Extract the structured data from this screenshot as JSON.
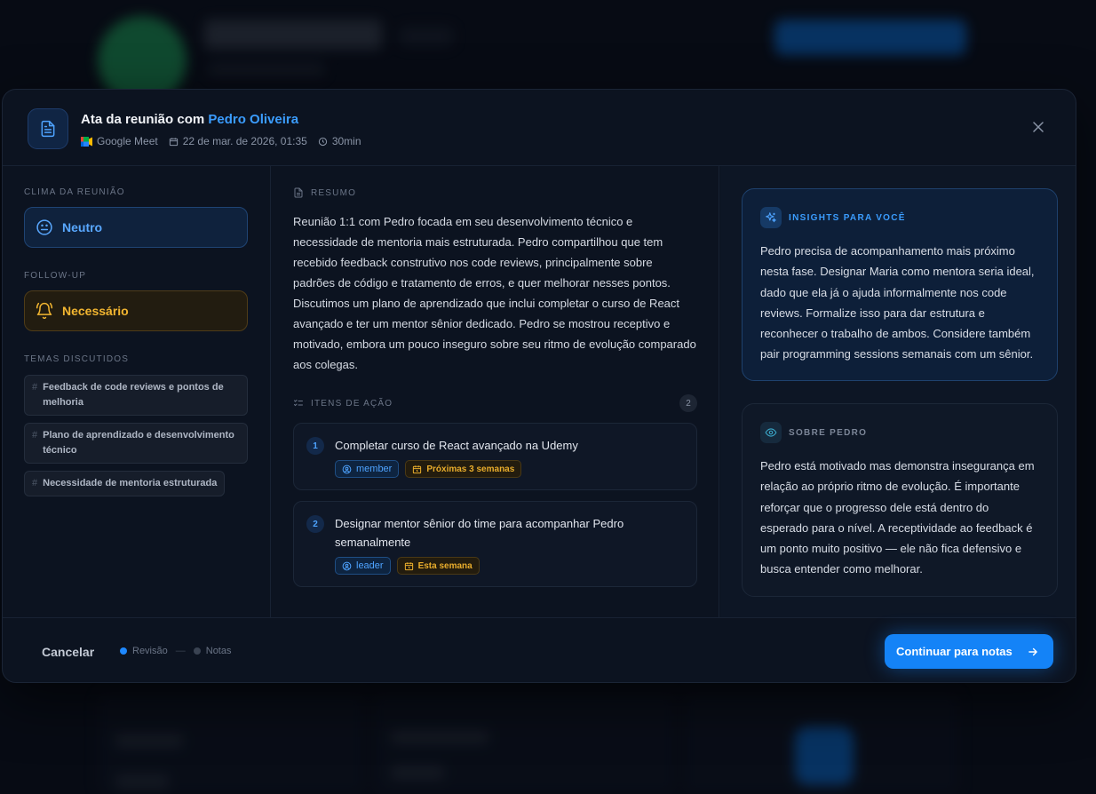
{
  "header": {
    "title_prefix": "Ata da reunião com",
    "person": "Pedro Oliveira",
    "platform": "Google Meet",
    "datetime": "22 de mar. de 2026, 01:35",
    "duration": "30min"
  },
  "left": {
    "mood_label": "CLIMA DA REUNIÃO",
    "mood_value": "Neutro",
    "followup_label": "FOLLOW-UP",
    "followup_value": "Necessário",
    "topics_label": "TEMAS DISCUTIDOS",
    "topics": [
      "Feedback de code reviews e pontos de melhoria",
      "Plano de aprendizado e desenvolvimento técnico",
      "Necessidade de mentoria estruturada"
    ]
  },
  "middle": {
    "summary_label": "RESUMO",
    "summary": "Reunião 1:1 com Pedro focada em seu desenvolvimento técnico e necessidade de mentoria mais estruturada. Pedro compartilhou que tem recebido feedback construtivo nos code reviews, principalmente sobre padrões de código e tratamento de erros, e quer melhorar nesses pontos. Discutimos um plano de aprendizado que inclui completar o curso de React avançado e ter um mentor sênior dedicado. Pedro se mostrou receptivo e motivado, embora um pouco inseguro sobre seu ritmo de evolução comparado aos colegas.",
    "actions_label": "ITENS DE AÇÃO",
    "actions_count": "2",
    "actions": [
      {
        "num": "1",
        "text": "Completar curso de React avançado na Udemy",
        "role": "member",
        "due": "Próximas 3 semanas"
      },
      {
        "num": "2",
        "text": "Designar mentor sênior do time para acompanhar Pedro semanalmente",
        "role": "leader",
        "due": "Esta semana"
      }
    ]
  },
  "right": {
    "insights_label": "INSIGHTS PARA VOCÊ",
    "insights_text": "Pedro precisa de acompanhamento mais próximo nesta fase. Designar Maria como mentora seria ideal, dado que ela já o ajuda informalmente nos code reviews. Formalize isso para dar estrutura e reconhecer o trabalho de ambos. Considere também pair programming sessions semanais com um sênior.",
    "about_label": "SOBRE PEDRO",
    "about_text": "Pedro está motivado mas demonstra insegurança em relação ao próprio ritmo de evolução. É importante reforçar que o progresso dele está dentro do esperado para o nível. A receptividade ao feedback é um ponto muito positivo — ele não fica defensivo e busca entender como melhorar."
  },
  "footer": {
    "cancel": "Cancelar",
    "step1": "Revisão",
    "step_sep": "—",
    "step2": "Notas",
    "continue": "Continuar para notas"
  },
  "colors": {
    "accent": "#1483f7",
    "warning": "#f2b530",
    "background": "#0c1320"
  }
}
